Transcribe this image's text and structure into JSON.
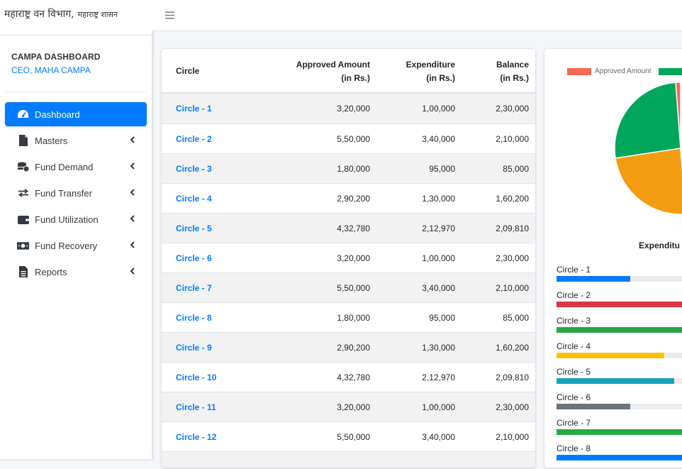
{
  "brand": {
    "title": "महाराष्ट्र वन विभाग,",
    "subtitle": "महाराष्ट्र शासन"
  },
  "user": {
    "name": "CAMPA DASHBOARD",
    "role": "CEO, MAHA CAMPA"
  },
  "menu": [
    {
      "label": "Dashboard",
      "icon": "tachometer-icon"
    },
    {
      "label": "Masters",
      "icon": "file-icon"
    },
    {
      "label": "Fund Demand",
      "icon": "coins-icon"
    },
    {
      "label": "Fund Transfer",
      "icon": "exchange-icon"
    },
    {
      "label": "Fund Utilization",
      "icon": "wallet-icon"
    },
    {
      "label": "Fund Recovery",
      "icon": "money-bill-icon"
    },
    {
      "label": "Reports",
      "icon": "file-alt-icon"
    }
  ],
  "table": {
    "headers": {
      "circle": "Circle",
      "approved_1": "Approved Amount",
      "approved_2": "(in Rs.)",
      "expenditure_1": "Expenditure",
      "expenditure_2": "(in Rs.)",
      "balance_1": "Balance",
      "balance_2": "(in Rs.)"
    },
    "rows": [
      {
        "circle": "Circle - 1",
        "approved": "3,20,000",
        "expenditure": "1,00,000",
        "balance": "2,30,000"
      },
      {
        "circle": "Circle - 2",
        "approved": "5,50,000",
        "expenditure": "3,40,000",
        "balance": "2,10,000"
      },
      {
        "circle": "Circle - 3",
        "approved": "1,80,000",
        "expenditure": "95,000",
        "balance": "85,000"
      },
      {
        "circle": "Circle - 4",
        "approved": "2,90,200",
        "expenditure": "1,30,000",
        "balance": "1,60,200"
      },
      {
        "circle": "Circle - 5",
        "approved": "4,32,780",
        "expenditure": "2,12,970",
        "balance": "2,09,810"
      },
      {
        "circle": "Circle - 6",
        "approved": "3,20,000",
        "expenditure": "1,00,000",
        "balance": "2,30,000"
      },
      {
        "circle": "Circle - 7",
        "approved": "5,50,000",
        "expenditure": "3,40,000",
        "balance": "2,10,000"
      },
      {
        "circle": "Circle - 8",
        "approved": "1,80,000",
        "expenditure": "95,000",
        "balance": "85,000"
      },
      {
        "circle": "Circle - 9",
        "approved": "2,90,200",
        "expenditure": "1,30,000",
        "balance": "1,60,200"
      },
      {
        "circle": "Circle - 10",
        "approved": "4,32,780",
        "expenditure": "2,12,970",
        "balance": "2,09,810"
      },
      {
        "circle": "Circle - 11",
        "approved": "3,20,000",
        "expenditure": "1,00,000",
        "balance": "2,30,000"
      },
      {
        "circle": "Circle - 12",
        "approved": "5,50,000",
        "expenditure": "3,40,000",
        "balance": "2,10,000"
      },
      {
        "circle": "",
        "approved": "",
        "expenditure": "",
        "balance": ""
      }
    ]
  },
  "pie_panel": {
    "legend": [
      {
        "label": "Approved Amount",
        "color": "#f56954"
      },
      {
        "label": "",
        "color": "#00a65a"
      }
    ],
    "slices": [
      {
        "color": "#f56954",
        "fraction": 0.012
      },
      {
        "color": "#00a65a",
        "fraction": 0.262
      },
      {
        "color": "#f39c12",
        "fraction": 0.238
      }
    ]
  },
  "expenditure_panel": {
    "title": "Expenditu",
    "bars": [
      {
        "label": "Circle - 1",
        "color": "#007bff",
        "fraction": 0.54
      },
      {
        "label": "Circle - 2",
        "color": "#dc3545",
        "fraction": 1.0
      },
      {
        "label": "Circle - 3",
        "color": "#28a745",
        "fraction": 1.0
      },
      {
        "label": "Circle - 4",
        "color": "#ffc107",
        "fraction": 0.79
      },
      {
        "label": "Circle - 5",
        "color": "#17a2b8",
        "fraction": 0.86
      },
      {
        "label": "Circle - 6",
        "color": "#6c757d",
        "fraction": 0.54
      },
      {
        "label": "Circle - 7",
        "color": "#28a745",
        "fraction": 1.0
      },
      {
        "label": "Circle - 8",
        "color": "#007bff",
        "fraction": 1.0
      }
    ]
  }
}
